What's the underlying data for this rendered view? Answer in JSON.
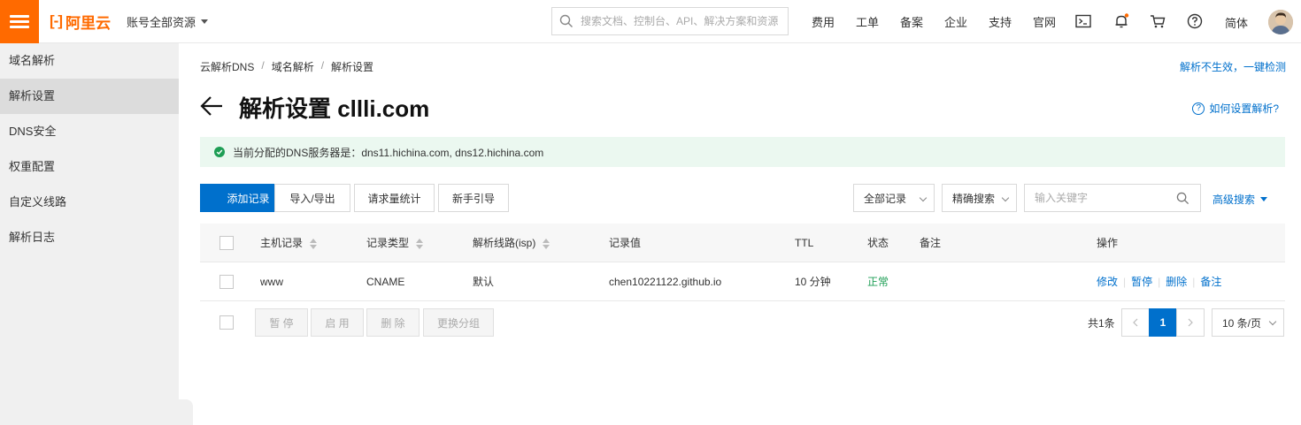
{
  "topbar": {
    "logo_text": "阿里云",
    "logo_mark": "[-]",
    "account_label": "账号全部资源",
    "search_placeholder": "搜索文档、控制台、API、解决方案和资源",
    "nav": [
      "费用",
      "工单",
      "备案",
      "企业",
      "支持",
      "官网"
    ],
    "lang": "简体",
    "brand_color": "#ff6a00",
    "icons": [
      "terminal-icon",
      "bell-icon",
      "cart-icon",
      "help-icon"
    ]
  },
  "sidebar": {
    "items": [
      {
        "label": "域名解析",
        "active": false
      },
      {
        "label": "解析设置",
        "active": true
      },
      {
        "label": "DNS安全",
        "active": false
      },
      {
        "label": "权重配置",
        "active": false
      },
      {
        "label": "自定义线路",
        "active": false
      },
      {
        "label": "解析日志",
        "active": false
      }
    ]
  },
  "breadcrumb": [
    "云解析DNS",
    "域名解析",
    "解析设置"
  ],
  "detect_link": "解析不生效，一键检测",
  "page": {
    "title": "解析设置 cllli.com",
    "help_link": "如何设置解析?"
  },
  "notice": {
    "text": "当前分配的DNS服务器是：dns11.hichina.com, dns12.hichina.com"
  },
  "toolbar": {
    "add": "添加记录",
    "import_export": "导入/导出",
    "request_stats": "请求量统计",
    "guide": "新手引导",
    "filter_select": "全部记录",
    "match_select": "精确搜索",
    "keyword_placeholder": "输入关键字",
    "advanced": "高级搜索"
  },
  "table": {
    "headers": {
      "host": "主机记录",
      "type": "记录类型",
      "line": "解析线路(isp)",
      "value": "记录值",
      "ttl": "TTL",
      "status": "状态",
      "remark": "备注",
      "actions": "操作"
    },
    "rows": [
      {
        "host": "www",
        "type": "CNAME",
        "line": "默认",
        "value": "chen10221122.github.io",
        "ttl": "10 分钟",
        "status": "正常",
        "remark": "",
        "actions": [
          "修改",
          "暂停",
          "删除",
          "备注"
        ]
      }
    ]
  },
  "footer": {
    "pause": "暂 停",
    "enable": "启 用",
    "delete": "删 除",
    "change_group": "更换分组",
    "total": "共1条",
    "current_page": "1",
    "page_size": "10 条/页"
  },
  "colors": {
    "primary": "#0070cc",
    "success": "#1e9e55",
    "notice_bg": "#ebf8f0"
  }
}
